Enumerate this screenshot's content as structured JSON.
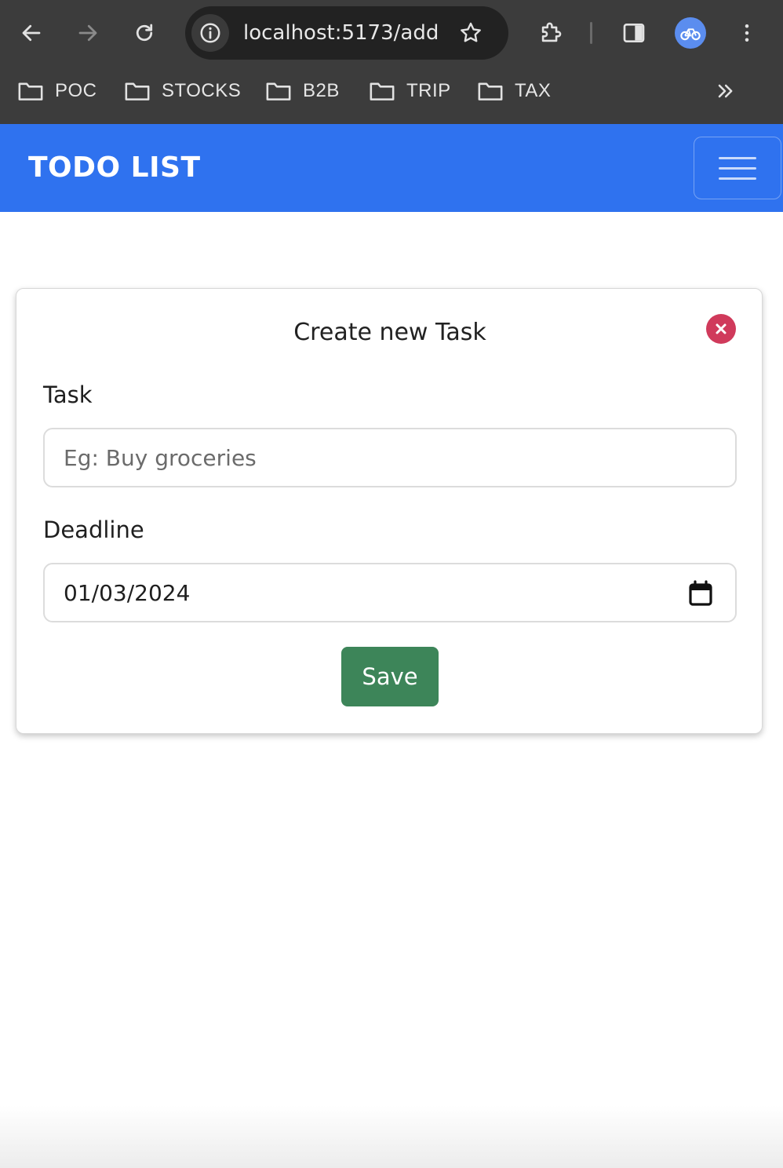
{
  "browser": {
    "url": "localhost:5173/add",
    "bookmarks": [
      {
        "label": "POC"
      },
      {
        "label": "STOCKS"
      },
      {
        "label": "B2B"
      },
      {
        "label": "TRIP"
      },
      {
        "label": "TAX"
      }
    ],
    "icons": [
      "back-arrow-icon",
      "forward-arrow-icon",
      "reload-icon",
      "site-info-icon",
      "bookmark-star-icon",
      "extensions-icon",
      "side-panel-icon",
      "profile-avatar",
      "more-vert-icon",
      "bookmarks-overflow-icon"
    ]
  },
  "navbar": {
    "brand": "TODO LIST",
    "color": "#2f72ef"
  },
  "form": {
    "title": "Create new Task",
    "task_label": "Task",
    "task_placeholder": "Eg: Buy groceries",
    "task_value": "",
    "deadline_label": "Deadline",
    "deadline_value": "01/03/2024",
    "save_label": "Save",
    "save_color": "#3d8559",
    "close_color": "#d03a5b"
  }
}
